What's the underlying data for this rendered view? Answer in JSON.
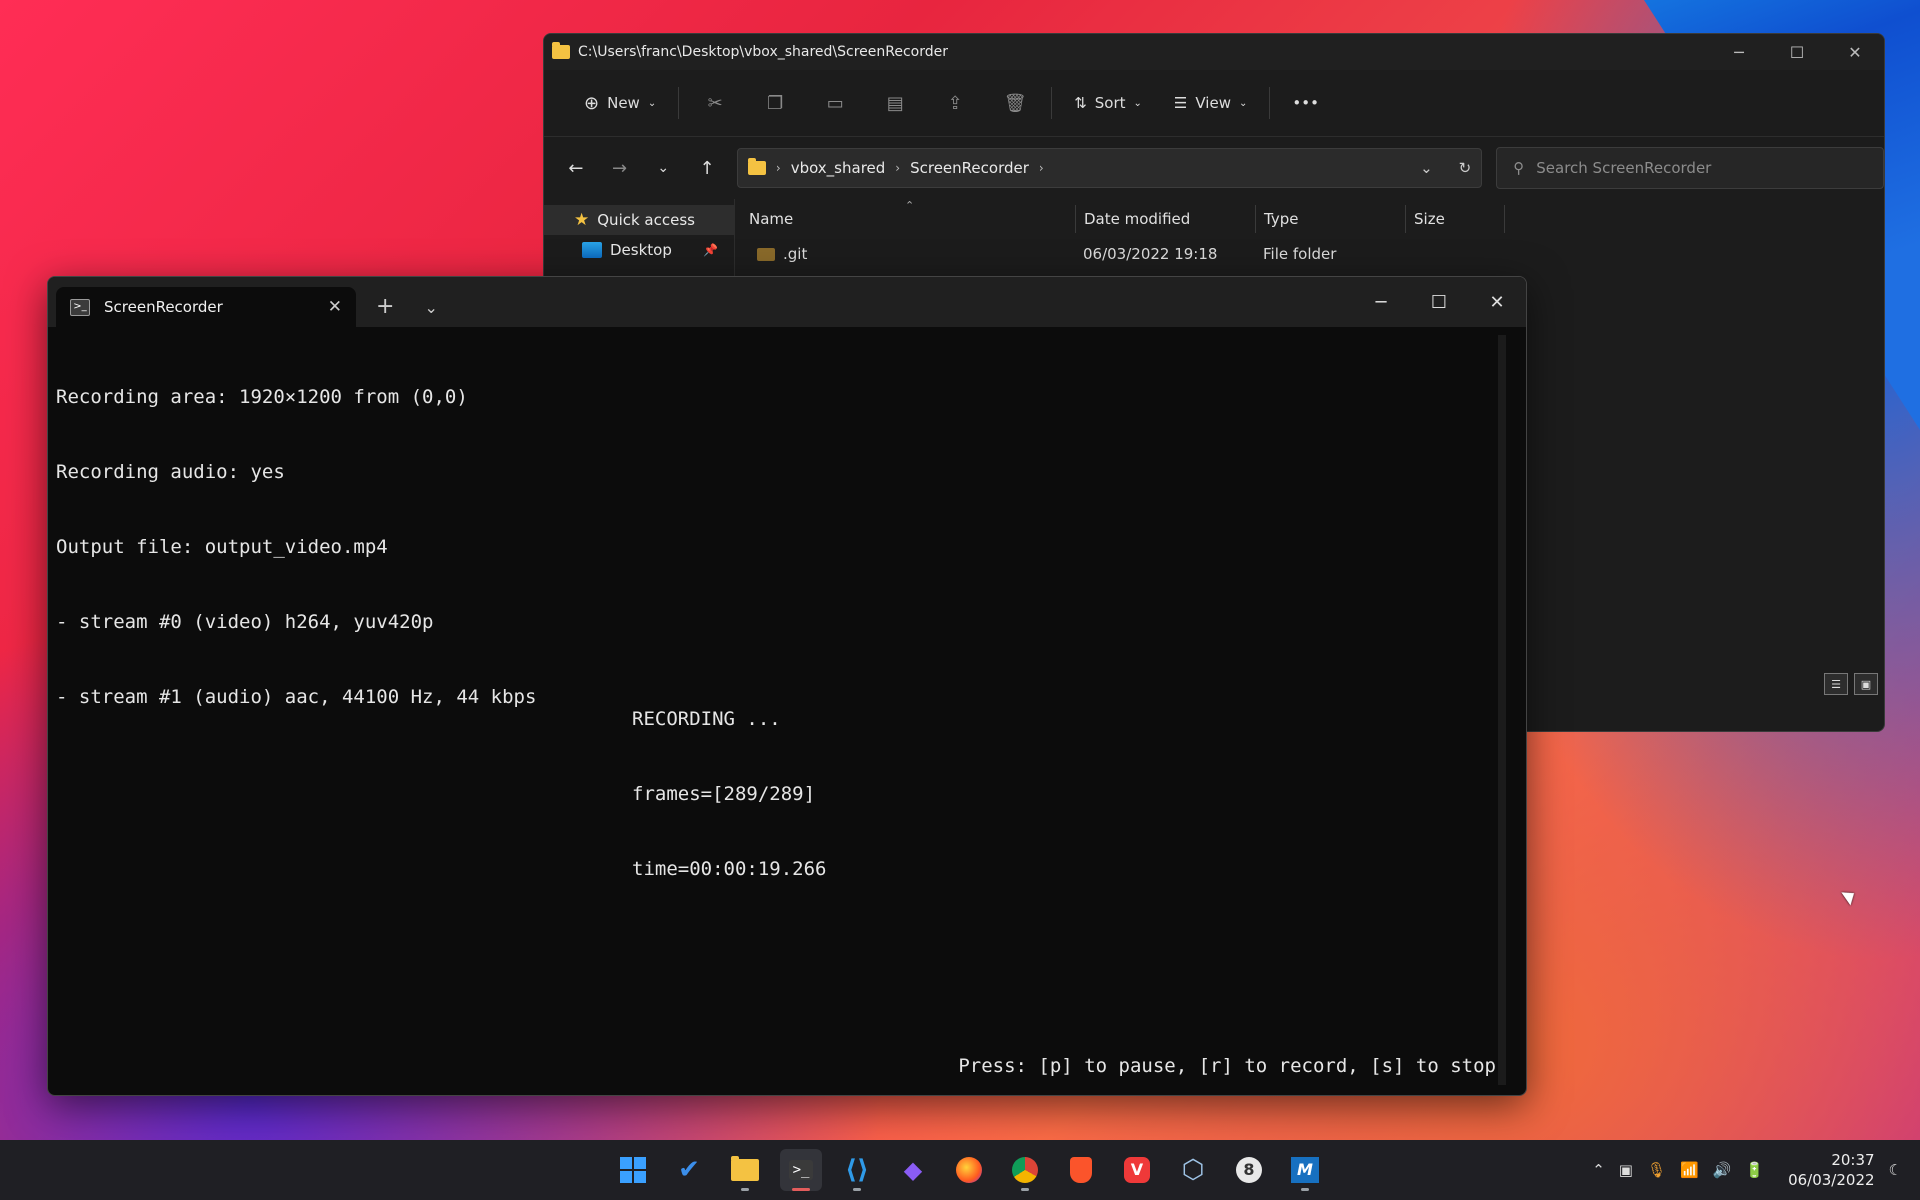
{
  "explorer": {
    "title": "C:\\Users\\franc\\Desktop\\vbox_shared\\ScreenRecorder",
    "toolbar": {
      "new_label": "New",
      "sort_label": "Sort",
      "view_label": "View",
      "more_label": "•••"
    },
    "breadcrumb": [
      "vbox_shared",
      "ScreenRecorder"
    ],
    "search_placeholder": "Search ScreenRecorder",
    "sidebar": [
      {
        "label": "Quick access",
        "icon": "star-icon"
      },
      {
        "label": "Desktop",
        "icon": "desktop-icon"
      }
    ],
    "columns": [
      "Name",
      "Date modified",
      "Type",
      "Size"
    ],
    "rows": [
      {
        "name": ".git",
        "date": "06/03/2022 19:18",
        "type": "File folder",
        "size": ""
      }
    ]
  },
  "terminal": {
    "tab_title": "ScreenRecorder",
    "lines": [
      "Recording area: 1920×1200 from (0,0)",
      "Recording audio: yes",
      "Output file: output_video.mp4",
      "- stream #0 (video) h264, yuv420p",
      "- stream #1 (audio) aac, 44100 Hz, 44 kbps"
    ],
    "status": [
      "RECORDING ...",
      "frames=[289/289]",
      "time=00:00:19.266"
    ],
    "hint": "Press: [p] to pause, [r] to record, [s] to stop"
  },
  "taskbar": {
    "time": "20:37",
    "date": "06/03/2022",
    "apps": [
      "start",
      "todo",
      "file-explorer",
      "terminal",
      "vscode",
      "obsidian",
      "firefox",
      "chrome",
      "brave",
      "vivaldi",
      "virtualbox",
      "app-8",
      "app-m"
    ]
  }
}
